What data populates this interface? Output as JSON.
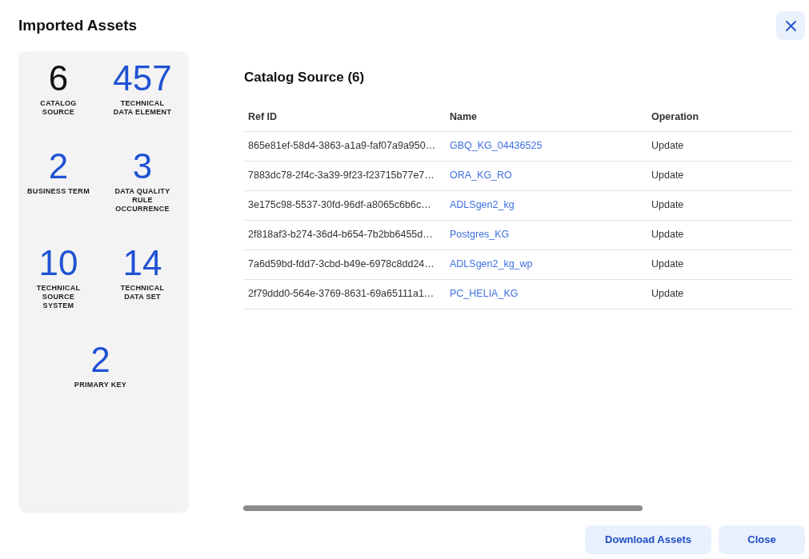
{
  "dialog": {
    "title": "Imported Assets"
  },
  "summary": [
    {
      "count": "6",
      "label": "CATALOG SOURCE",
      "selected": true
    },
    {
      "count": "457",
      "label": "TECHNICAL DATA ELEMENT",
      "selected": false
    },
    {
      "count": "2",
      "label": "BUSINESS TERM",
      "selected": false
    },
    {
      "count": "3",
      "label": "DATA QUALITY RULE OCCURRENCE",
      "selected": false
    },
    {
      "count": "10",
      "label": "TECHNICAL SOURCE SYSTEM",
      "selected": false
    },
    {
      "count": "14",
      "label": "TECHNICAL DATA SET",
      "selected": false
    },
    {
      "count": "2",
      "label": "PRIMARY KEY",
      "selected": false
    }
  ],
  "detail": {
    "title": "Catalog Source (6)",
    "table": {
      "columns": [
        {
          "label": "Ref ID",
          "kind": "text"
        },
        {
          "label": "Name",
          "kind": "link"
        },
        {
          "label": "Operation",
          "kind": "text"
        }
      ],
      "rows": [
        [
          "865e81ef-58d4-3863-a1a9-faf07a9a950…",
          "GBQ_KG_04436525",
          "Update"
        ],
        [
          "7883dc78-2f4c-3a39-9f23-f23715b77e7…",
          "ORA_KG_RO",
          "Update"
        ],
        [
          "3e175c98-5537-30fd-96df-a8065c6b6c…",
          "ADLSgen2_kg",
          "Update"
        ],
        [
          "2f818af3-b274-36d4-b654-7b2bb6455d…",
          "Postgres_KG",
          "Update"
        ],
        [
          "7a6d59bd-fdd7-3cbd-b49e-6978c8dd24…",
          "ADLSgen2_kg_wp",
          "Update"
        ],
        [
          "2f79ddd0-564e-3769-8631-69a65111a1…",
          "PC_HELIA_KG",
          "Update"
        ]
      ]
    }
  },
  "buttons": [
    "Download Assets",
    "Close"
  ]
}
